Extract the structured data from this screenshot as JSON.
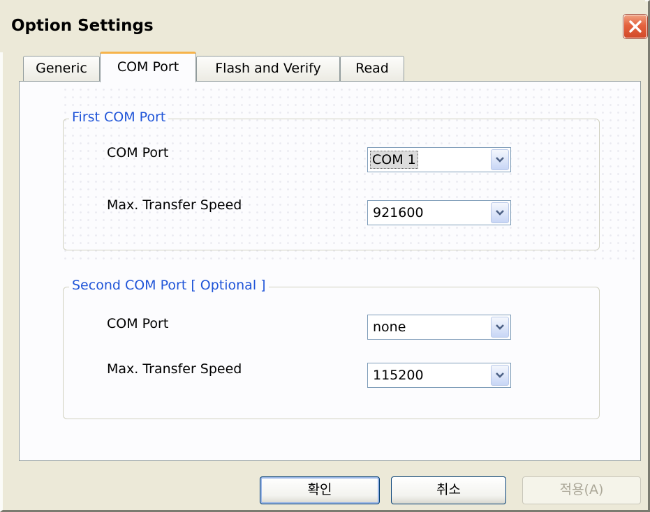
{
  "window": {
    "title": "Option Settings",
    "close_icon": "close-icon"
  },
  "tabs": [
    {
      "label": "Generic",
      "active": false
    },
    {
      "label": "COM Port",
      "active": true
    },
    {
      "label": "Flash and Verify",
      "active": false
    },
    {
      "label": "Read",
      "active": false
    }
  ],
  "first_group": {
    "legend": "First COM Port",
    "com_port_label": "COM Port",
    "com_port_value": "COM 1",
    "speed_label": "Max. Transfer Speed",
    "speed_value": "921600"
  },
  "second_group": {
    "legend": "Second COM Port [ Optional ]",
    "com_port_label": "COM Port",
    "com_port_value": "none",
    "speed_label": "Max. Transfer Speed",
    "speed_value": "115200"
  },
  "buttons": {
    "ok": "확인",
    "cancel": "취소",
    "apply": "적용(A)"
  },
  "colors": {
    "accent_blue": "#2055d8",
    "tab_highlight": "#f6b34a",
    "close_red": "#e4623e"
  }
}
